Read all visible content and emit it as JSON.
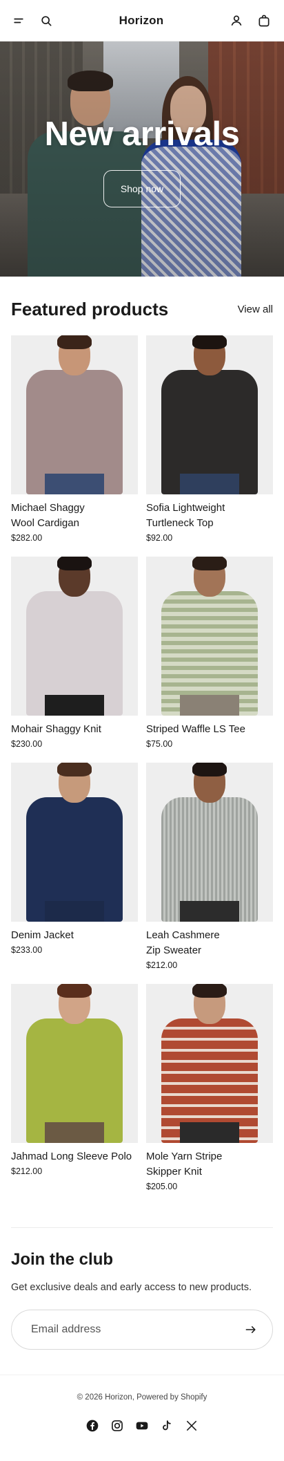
{
  "header": {
    "brand": "Horizon",
    "icons": [
      "menu-icon",
      "search-icon",
      "account-icon",
      "bag-icon"
    ]
  },
  "hero": {
    "title": "New arrivals",
    "button_label": "Shop now"
  },
  "featured": {
    "title": "Featured products",
    "view_all_label": "View all",
    "products": [
      {
        "name_line1": "Michael Shaggy",
        "name_line2": "Wool Cardigan",
        "price": "$282.00"
      },
      {
        "name_line1": "Sofia Lightweight",
        "name_line2": "Turtleneck Top",
        "price": "$92.00"
      },
      {
        "name_line1": "Mohair Shaggy Knit",
        "name_line2": "",
        "price": "$230.00"
      },
      {
        "name_line1": "Striped Waffle LS Tee",
        "name_line2": "",
        "price": "$75.00"
      },
      {
        "name_line1": "Denim Jacket",
        "name_line2": "",
        "price": "$233.00"
      },
      {
        "name_line1": "Leah Cashmere",
        "name_line2": "Zip Sweater",
        "price": "$212.00"
      },
      {
        "name_line1": "Jahmad Long Sleeve Polo",
        "name_line2": "",
        "price": "$212.00"
      },
      {
        "name_line1": "Mole Yarn Stripe",
        "name_line2": "Skipper Knit",
        "price": "$205.00"
      }
    ]
  },
  "club": {
    "title": "Join the club",
    "text": "Get exclusive deals and early access to new products.",
    "email_placeholder": "Email address"
  },
  "footer": {
    "copyright": "© 2026 Horizon, Powered by Shopify",
    "social_icons": [
      "facebook-icon",
      "instagram-icon",
      "youtube-icon",
      "tiktok-icon",
      "x-icon"
    ]
  },
  "colors": {
    "text": "#1a1a1a",
    "background": "#ffffff",
    "card_bg": "#eeeeee",
    "border": "#d9d9d9"
  }
}
